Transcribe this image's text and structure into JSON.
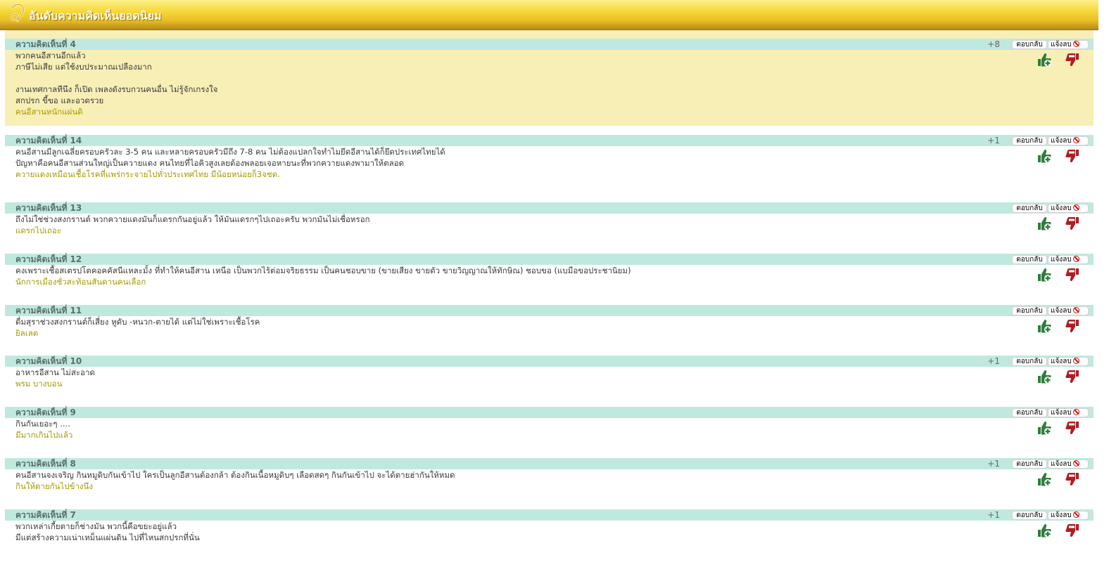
{
  "header": {
    "title": "อันดับความคิดเห็นยอดนิยม"
  },
  "buttons": {
    "reply": "ตอบกลับ",
    "report": "แจ้งลบ"
  },
  "icons": {
    "logo": "gold-swirl-logo",
    "up": "thumbs-up-plus-icon",
    "down": "thumbs-down-minus-icon",
    "report": "prohibited-icon"
  },
  "colors": {
    "bar": "#bfe9df",
    "highlight": "#f8efb6",
    "author": "#a39a00",
    "up": "#2f7d3b",
    "down": "#b01c24"
  },
  "comments": [
    {
      "title": "ความคิดเห็นที่ 4",
      "score": "+8",
      "highlight": true,
      "lines": [
        "พวกคนอีสานอีกแล้ว",
        "ภาษีไม่เสีย แต่ใช้งบประมาณเปลืองมาก",
        "",
        "งานเทศกาลทีนึง ก็เปิด เพลงดังรบกวนคนอื่น ไม่รู้จักเกรงใจ",
        "สกปรก ขี้ขอ และอวดรวย"
      ],
      "author": "คนอีสานหนักแผ่นดิ"
    },
    {
      "title": "ความคิดเห็นที่ 14",
      "score": "+1",
      "highlight": false,
      "lines": [
        "คนอีสานมีลูกเฉลี่ยครอบครัวละ 3-5 คน และหลายครอบครัวมีถึง 7-8 คน ไม่ต้องแปลกใจทำไมยึดอีสานได้ก็ยึดประเทศไทยได้",
        "ปัญหาคือคนอีสานส่วนใหญ่เป็นควายแดง คนไทยที่ไอคิวสูงเลยต้องพลอยเจอหายนะที่พวกควายแดงพามาให้ตลอด"
      ],
      "author": "ควายแดงเหมือนเชื้อโรคที่แพร่กระจายไปทั่วประเทศไทย มีน้อยหน่อยก็3จชด."
    },
    {
      "title": "ความคิดเห็นที่ 13",
      "score": "",
      "highlight": false,
      "lines": [
        "ถึงไม่ใช่ช่วงสงกรานต์ พวกควายแดงมันก็แดรกกันอยู่แล้ว ให้มันแดรกๆไปเถอะครับ พวกมันไม่เชื่อหรอก"
      ],
      "author": "แดรกไปเถอะ"
    },
    {
      "title": "ความคิดเห็นที่ 12",
      "score": "",
      "highlight": false,
      "lines": [
        "คงเพราะเชื้อสเตรปโตคอคคัสนีแหละมั้ง ที่ทำให้คนอีสาน เหนือ เป็นพวกไร้ต่อมจริยธรรม เป็นคนชอบขาย (ขายเสียง ขายตัว ขายวิญญาณให้ทักษิณ) ชอบขอ (แบมือขอประชานิยม)"
      ],
      "author": "นักการเมืองชั่วสะท้อนสันดานคนเลือก"
    },
    {
      "title": "ความคิดเห็นที่ 11",
      "score": "",
      "highlight": false,
      "lines": [
        "ดื่มสุราช่วงสงกรานต์ก็เสี่ยง หูดับ -หนวก-ตายได้ แต่ไม่ใช่เพราะเชื้อโรค"
      ],
      "author": "ยิลเลต"
    },
    {
      "title": "ความคิดเห็นที่ 10",
      "score": "+1",
      "highlight": false,
      "lines": [
        "อาหารอีสาน ไม่สะอาด"
      ],
      "author": "พรม บางบอน"
    },
    {
      "title": "ความคิดเห็นที่ 9",
      "score": "",
      "highlight": false,
      "lines": [
        "กินกันเยอะๆ ...."
      ],
      "author": "มีมากเกินไปแล้ว"
    },
    {
      "title": "ความคิดเห็นที่ 8",
      "score": "+1",
      "highlight": false,
      "lines": [
        "คนอีสานจงเจริญ กินหมูดิบกันเข้าไป ใครเป็นลูกอีสานต้องกล้า ต้องกินเนื้อหมูดิบๆ เลือดสดๆ กินกันเข้าไป จะได้ตายฮ่ากันให้หมด"
      ],
      "author": "กินให้ตายกันไปข้างนึง"
    },
    {
      "title": "ความคิดเห็นที่ 7",
      "score": "+1",
      "highlight": false,
      "lines": [
        "พวกเหล่าเกี้ยตายก็ช่างมัน พวกนี้คือขยะอยู่แล้ว",
        "มีแต่สร้างความเน่าเหม็นแผ่นดิน ไปที่ไหนสกปรกที่นั่น"
      ],
      "author": ""
    }
  ]
}
